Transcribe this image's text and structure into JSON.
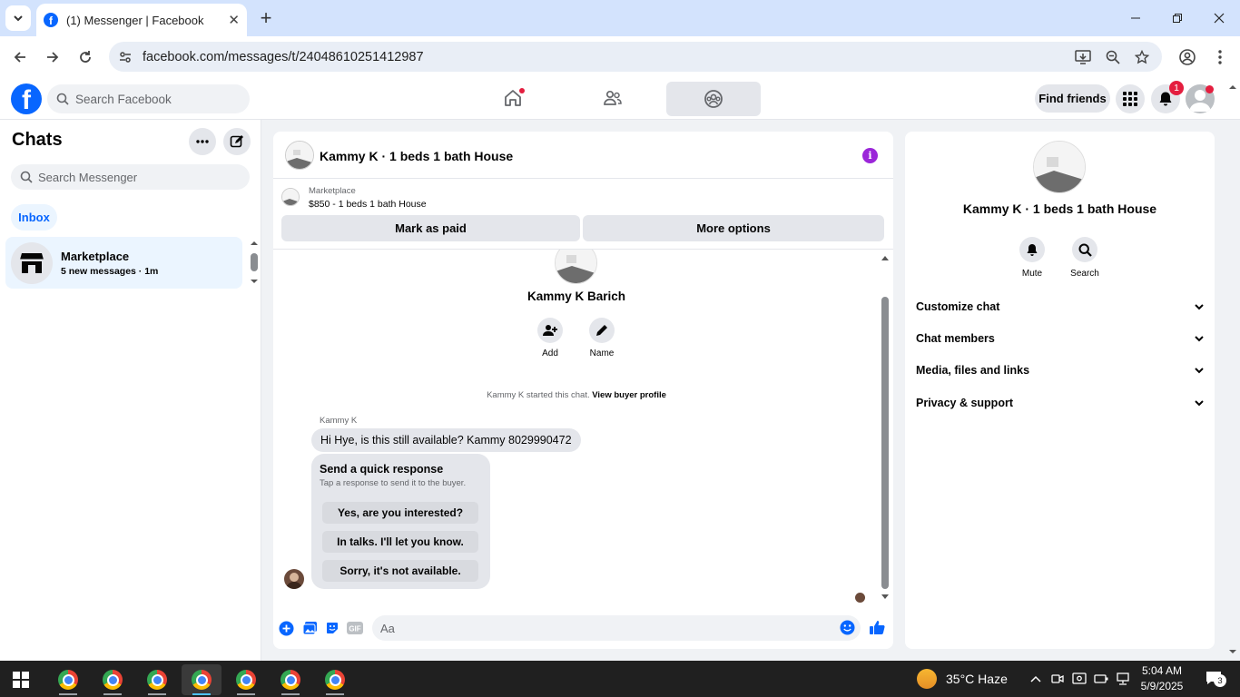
{
  "browser": {
    "tab_title": "(1) Messenger | Facebook",
    "url": "facebook.com/messages/t/24048610251412987"
  },
  "fb_nav": {
    "search_placeholder": "Search Facebook",
    "find_friends": "Find friends",
    "notification_count": "1"
  },
  "chats": {
    "title": "Chats",
    "search_placeholder": "Search Messenger",
    "filter": "Inbox",
    "items": [
      {
        "name": "Marketplace",
        "preview": "5 new messages · 1m"
      }
    ]
  },
  "conversation": {
    "title": "Kammy K · 1 beds 1 bath House",
    "listing": {
      "label": "Marketplace",
      "price_title": "$850 - 1 beds 1 bath House",
      "mark_paid": "Mark as paid",
      "more_options": "More options"
    },
    "profile_name": "Kammy K Barich",
    "actions": [
      {
        "label": "Add",
        "icon": "add-person-icon"
      },
      {
        "label": "Name",
        "icon": "pencil-icon"
      }
    ],
    "started_text": "Kammy K started this chat.",
    "view_profile": "View buyer profile",
    "sender": "Kammy K",
    "message": "Hi Hye, is this still available? Kammy 8029990472",
    "quick_response": {
      "title": "Send a quick response",
      "subtitle": "Tap a response to send it to the buyer.",
      "options": [
        "Yes, are you interested?",
        "In talks. I'll let you know.",
        "Sorry, it's not available."
      ]
    },
    "composer_placeholder": "Aa"
  },
  "details": {
    "name": "Kammy K · 1 beds 1 bath House",
    "actions": [
      {
        "label": "Mute",
        "icon": "bell-icon"
      },
      {
        "label": "Search",
        "icon": "search-icon"
      }
    ],
    "sections": [
      "Customize chat",
      "Chat members",
      "Media, files and links",
      "Privacy & support"
    ]
  },
  "taskbar": {
    "weather": "35°C  Haze",
    "time": "5:04 AM",
    "date": "5/9/2025",
    "notifications": "3"
  },
  "colors": {
    "fb_blue": "#0866ff",
    "accent_purple": "#9b26d9",
    "badge_red": "#e41e3f"
  }
}
